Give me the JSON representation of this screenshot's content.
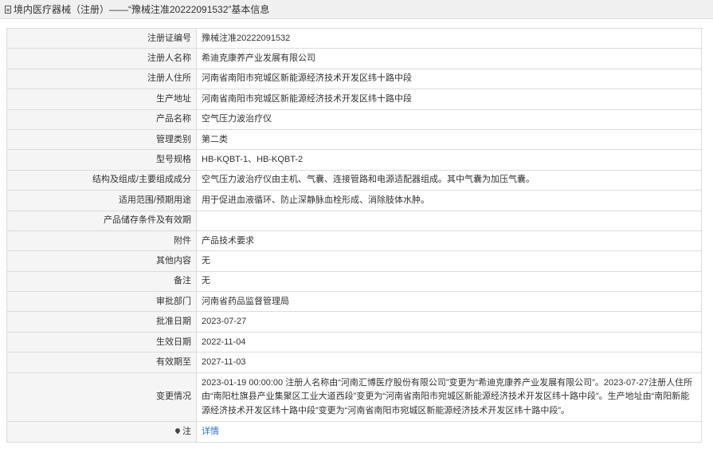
{
  "header": {
    "title": "境内医疗器械（注册）——“豫械注准20222091532”基本信息"
  },
  "rows": [
    {
      "label": "注册证编号",
      "value": "豫械注准20222091532"
    },
    {
      "label": "注册人名称",
      "value": "希迪克康养产业发展有限公司"
    },
    {
      "label": "注册人住所",
      "value": "河南省南阳市宛城区新能源经济技术开发区纬十路中段"
    },
    {
      "label": "生产地址",
      "value": "河南省南阳市宛城区新能源经济技术开发区纬十路中段"
    },
    {
      "label": "产品名称",
      "value": "空气压力波治疗仪"
    },
    {
      "label": "管理类别",
      "value": "第二类"
    },
    {
      "label": "型号规格",
      "value": "HB-KQBT-1、HB-KQBT-2"
    },
    {
      "label": "结构及组成/主要组成成分",
      "value": "空气压力波治疗仪由主机、气囊、连接管路和电源适配器组成。其中气囊为加压气囊。"
    },
    {
      "label": "适用范围/预期用途",
      "value": "用于促进血液循环、防止深静脉血栓形成、消除肢体水肿。"
    },
    {
      "label": "产品储存条件及有效期",
      "value": ""
    },
    {
      "label": "附件",
      "value": "产品技术要求"
    },
    {
      "label": "其他内容",
      "value": "无"
    },
    {
      "label": "备注",
      "value": "无"
    },
    {
      "label": "审批部门",
      "value": "河南省药品监督管理局"
    },
    {
      "label": "批准日期",
      "value": "2023-07-27"
    },
    {
      "label": "生效日期",
      "value": "2022-11-04"
    },
    {
      "label": "有效期至",
      "value": "2027-11-03"
    },
    {
      "label": "变更情况",
      "value": "2023-01-19 00:00:00 注册人名称由“河南汇博医疗股份有限公司”变更为“希迪克康养产业发展有限公司”。2023-07-27注册人住所由“南阳杜旗县产业集聚区工业大道西段”变更为“河南省南阳市宛城区新能源经济技术开发区纬十路中段”。生产地址由“南阳新能源经济技术开发区纬十路中段”变更为“河南省南阳市宛城区新能源经济技术开发区纬十路中段”。"
    }
  ],
  "note": {
    "label": "注",
    "link_text": "详情",
    "link_color": "#2e6fc0",
    "icon": "pin-icon"
  }
}
